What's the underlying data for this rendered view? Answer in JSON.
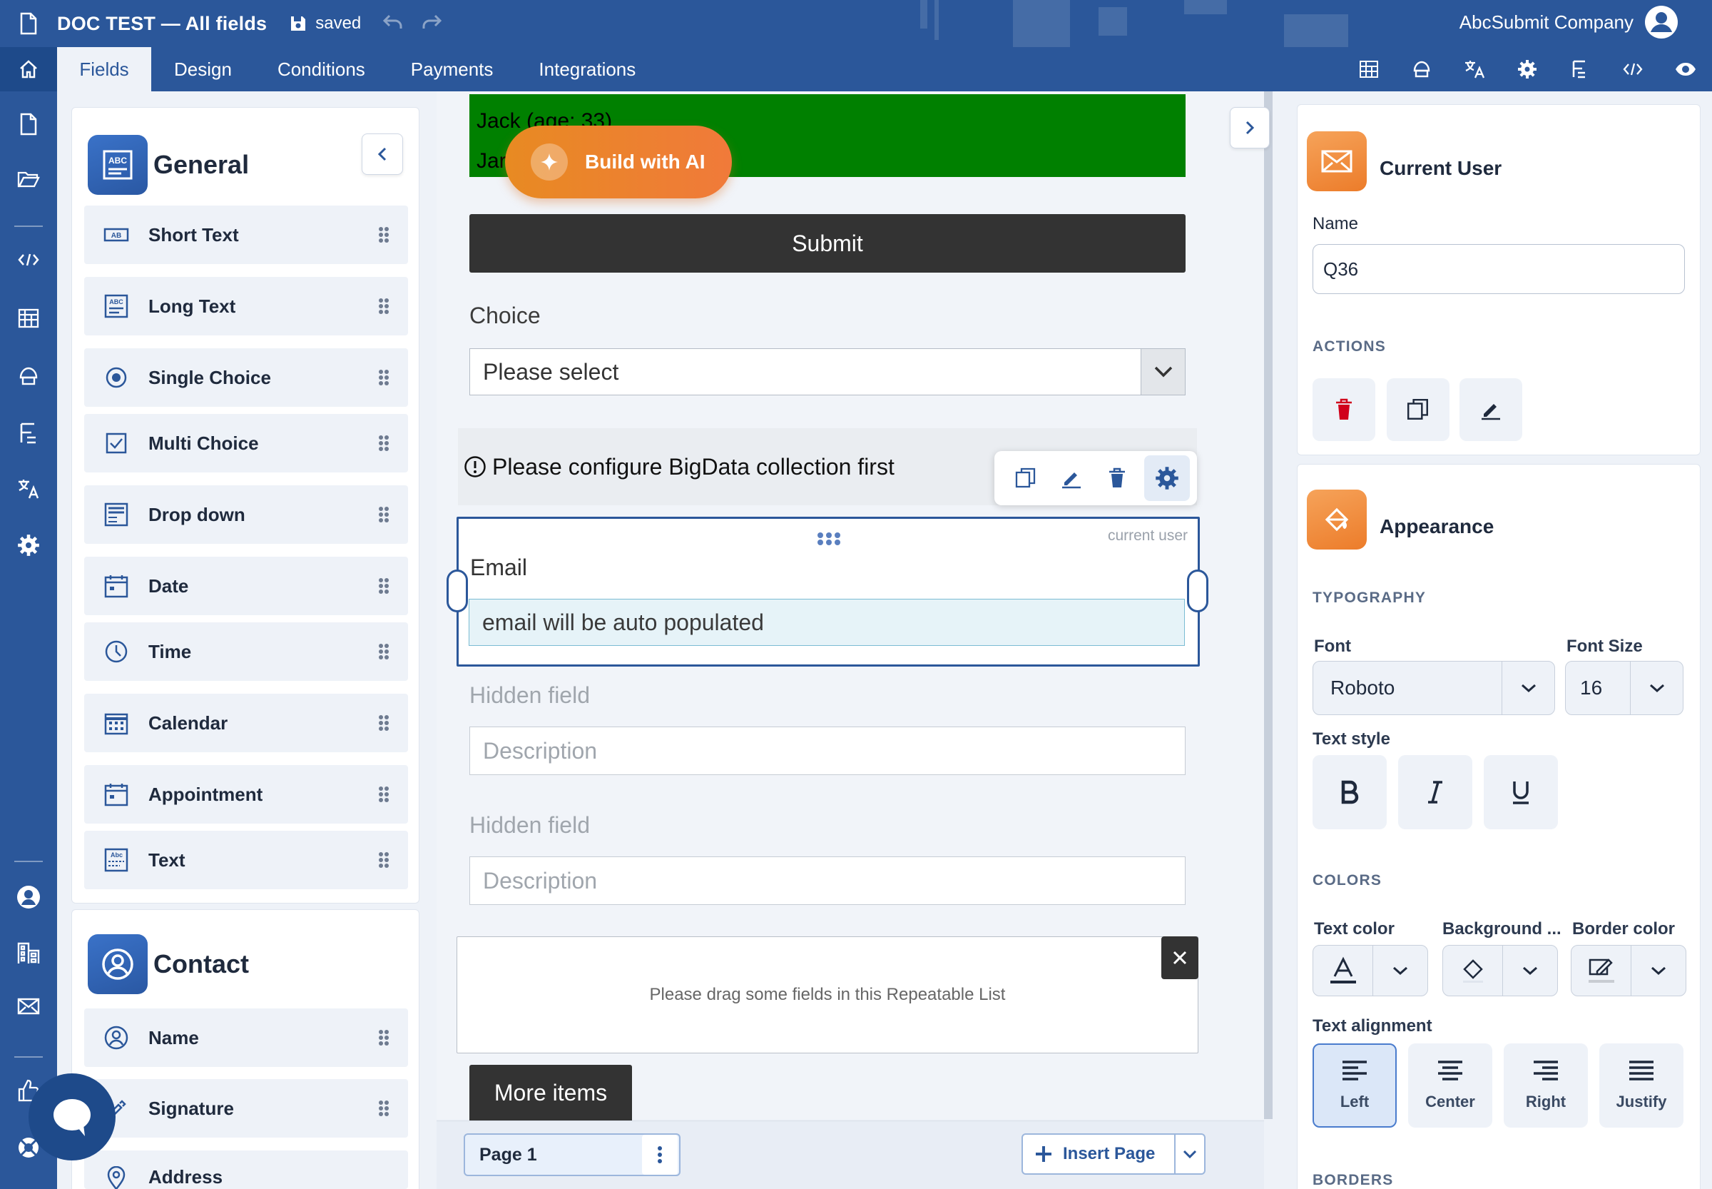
{
  "header": {
    "title": "DOC TEST — All fields",
    "saved": "saved",
    "company": "AbcSubmit Company"
  },
  "nav": {
    "tabs": [
      "Fields",
      "Design",
      "Conditions",
      "Payments",
      "Integrations"
    ]
  },
  "left_panel": {
    "general_title": "General",
    "items": [
      "Short Text",
      "Long Text",
      "Single Choice",
      "Multi Choice",
      "Drop down",
      "Date",
      "Time",
      "Calendar",
      "Appointment",
      "Text"
    ],
    "contact_title": "Contact",
    "contact_items": [
      "Name",
      "Signature",
      "Address"
    ]
  },
  "canvas": {
    "green_line1": "Jack (age: 33)",
    "green_line2": "Jar",
    "build_ai": "Build with AI",
    "submit": "Submit",
    "choice_label": "Choice",
    "choice_value": "Please select",
    "bigdata_notice": "Please configure BigData collection first",
    "email_tag": "current user",
    "email_label": "Email",
    "email_value": "email will be auto populated",
    "hidden1_label": "Hidden field",
    "hidden1_placeholder": "Description",
    "hidden2_label": "Hidden field",
    "hidden2_placeholder": "Description",
    "repeat_text": "Please drag some fields in this Repeatable List",
    "more_items": "More items",
    "page_tab": "Page 1",
    "insert_page": "Insert Page"
  },
  "right_panel": {
    "current_user_title": "Current User",
    "name_label": "Name",
    "name_value": "Q36",
    "actions_label": "ACTIONS",
    "appearance_title": "Appearance",
    "typography_label": "TYPOGRAPHY",
    "font_label": "Font",
    "font_value": "Roboto",
    "font_size_label": "Font Size",
    "font_size_value": "16",
    "text_style_label": "Text style",
    "colors_label": "COLORS",
    "text_color_label": "Text color",
    "background_label": "Background ...",
    "border_color_label": "Border color",
    "text_alignment_label": "Text alignment",
    "align_left": "Left",
    "align_center": "Center",
    "align_right": "Right",
    "align_justify": "Justify",
    "borders_label": "BORDERS"
  },
  "colors": {
    "primary": "#2b579a",
    "green_block": "#008000",
    "ai_orange": "#ef7f2e",
    "delete_red": "#d0021b"
  }
}
